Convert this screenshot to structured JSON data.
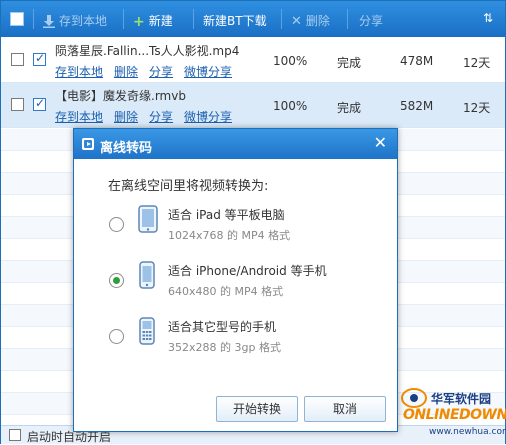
{
  "toolbar": {
    "items": [
      {
        "label": "存到本地",
        "icon": "save-download-icon"
      },
      {
        "label": "新建",
        "icon": "plus-icon"
      },
      {
        "label": "新建BT下载",
        "icon": ""
      },
      {
        "label": "删除",
        "icon": "close-icon"
      },
      {
        "label": "分享",
        "icon": ""
      }
    ],
    "sort_icon": "sort-arrows-icon",
    "bg_color": "#1f78cc"
  },
  "files": [
    {
      "name": "陨落星辰.Fallin...Ts人人影视.mp4",
      "actions": [
        "存到本地",
        "删除",
        "分享",
        "微博分享"
      ],
      "progress": "100%",
      "status": "完成",
      "size": "478M",
      "remaining": "12天"
    },
    {
      "name": "【电影】魔发奇缘.rmvb",
      "actions": [
        "存到本地",
        "删除",
        "分享",
        "微博分享"
      ],
      "progress": "100%",
      "status": "完成",
      "size": "582M",
      "remaining": "12天"
    }
  ],
  "bottom": {
    "autostart_label": "启动时自动开启"
  },
  "watermark": {
    "line1": "华军软件园",
    "line2": "ONLINEDOWN",
    "url": "www.newhua.com"
  },
  "dialog": {
    "title": "离线转码",
    "prompt": "在离线空间里将视频转换为:",
    "options": [
      {
        "title": "适合 iPad 等平板电脑",
        "subtitle": "1024x768 的 MP4 格式",
        "icon": "tablet-icon",
        "selected": false
      },
      {
        "title": "适合 iPhone/Android 等手机",
        "subtitle": "640x480 的 MP4 格式",
        "icon": "smartphone-icon",
        "selected": true
      },
      {
        "title": "适合其它型号的手机",
        "subtitle": "352x288 的 3gp 格式",
        "icon": "feature-phone-icon",
        "selected": false
      }
    ],
    "start_label": "开始转换",
    "cancel_label": "取消",
    "accent_color": "#2f9d3c"
  }
}
